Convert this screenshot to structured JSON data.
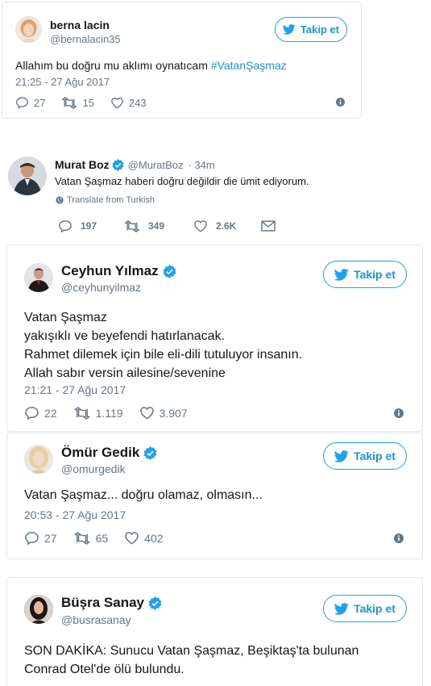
{
  "tweets": [
    {
      "name": "berna lacin",
      "handle": "@bernalacin35",
      "text": "Allahım bu doğru mu aklımı oynatıcam ",
      "hashtag": "#VatanŞaşmaz",
      "time": "21:25 - 27 Ağu 2017",
      "replies": "27",
      "retweets": "15",
      "likes": "243",
      "follow_label": "Takip et"
    },
    {
      "name": "Murat Boz",
      "handle": "@MuratBoz",
      "age": "· 34m",
      "text": "Vatan Şaşmaz haberi doğru değildir die ümit ediyorum.",
      "translate": "Translate from Turkish",
      "replies": "197",
      "retweets": "349",
      "likes": "2.6K"
    },
    {
      "name": "Ceyhun Yılmaz",
      "handle": "@ceyhunyilmaz",
      "lines": [
        "Vatan Şaşmaz",
        "yakışıklı ve beyefendi hatırlanacak.",
        "Rahmet dilemek için bile eli-dili tutuluyor insanın.",
        "Allah sabır versin ailesine/sevenine"
      ],
      "time": "21:21 - 27 Ağu 2017",
      "replies": "22",
      "retweets": "1.119",
      "likes": "3.907",
      "follow_label": "Takip et"
    },
    {
      "name": "Ömür Gedik",
      "handle": "@omurgedik",
      "text": "Vatan Şaşmaz... doğru olamaz, olmasın...",
      "time": "20:53 - 27 Ağu 2017",
      "replies": "27",
      "retweets": "65",
      "likes": "402",
      "follow_label": "Takip et"
    },
    {
      "name": "Büşra Sanay",
      "handle": "@busrasanay",
      "lines": [
        "SON DAKİKA: Sunucu Vatan Şaşmaz, Beşiktaş'ta bulunan",
        "Conrad Otel'de ölü bulundu."
      ],
      "follow_label": "Takip et"
    }
  ],
  "colors": {
    "accent": "#1da1f2",
    "link": "#1b95e0",
    "muted": "#657786",
    "verified": "#1da1f2"
  }
}
